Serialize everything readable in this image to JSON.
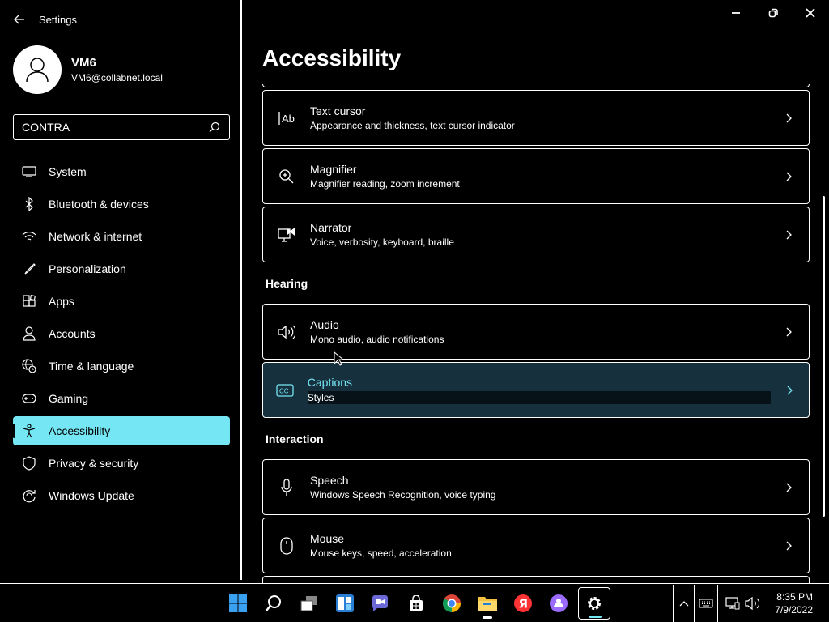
{
  "app": {
    "title": "Settings"
  },
  "user": {
    "name": "VM6",
    "email": "VM6@collabnet.local"
  },
  "search": {
    "value": "CONTRA",
    "icon": "search-icon"
  },
  "nav": {
    "items": [
      {
        "label": "System",
        "icon": "monitor-icon"
      },
      {
        "label": "Bluetooth & devices",
        "icon": "bluetooth-icon"
      },
      {
        "label": "Network & internet",
        "icon": "wifi-icon"
      },
      {
        "label": "Personalization",
        "icon": "brush-icon"
      },
      {
        "label": "Apps",
        "icon": "apps-icon"
      },
      {
        "label": "Accounts",
        "icon": "person-icon"
      },
      {
        "label": "Time & language",
        "icon": "globe-clock-icon"
      },
      {
        "label": "Gaming",
        "icon": "gamepad-icon"
      },
      {
        "label": "Accessibility",
        "icon": "accessibility-icon"
      },
      {
        "label": "Privacy & security",
        "icon": "shield-icon"
      },
      {
        "label": "Windows Update",
        "icon": "update-icon"
      }
    ],
    "selected": "Accessibility"
  },
  "main": {
    "title": "Accessibility",
    "cards": [
      {
        "title": "Text cursor",
        "desc": "Appearance and thickness, text cursor indicator",
        "icon": "text-cursor-icon"
      },
      {
        "title": "Magnifier",
        "desc": "Magnifier reading, zoom increment",
        "icon": "magnifier-icon"
      },
      {
        "title": "Narrator",
        "desc": "Voice, verbosity, keyboard, braille",
        "icon": "narrator-icon"
      },
      {
        "title": "Audio",
        "desc": "Mono audio, audio notifications",
        "icon": "speaker-icon"
      },
      {
        "title": "Captions",
        "desc": "Styles",
        "icon": "captions-icon"
      },
      {
        "title": "Speech",
        "desc": "Windows Speech Recognition, voice typing",
        "icon": "microphone-icon"
      },
      {
        "title": "Mouse",
        "desc": "Mouse keys, speed, acceleration",
        "icon": "mouse-icon"
      }
    ],
    "sections": {
      "hearing": "Hearing",
      "interaction": "Interaction"
    }
  },
  "window": {
    "minimize": "minimize-icon",
    "restore": "restore-icon",
    "close": "close-icon"
  },
  "taskbar": {
    "apps": [
      "start-icon",
      "search-icon",
      "task-view-icon",
      "widgets-icon",
      "chat-icon",
      "store-icon",
      "chrome-icon",
      "file-explorer-icon",
      "yandex-icon",
      "alice-icon",
      "settings-icon"
    ],
    "time": "8:35 PM",
    "date": "7/9/2022"
  },
  "colors": {
    "accent": "#75e6f4",
    "hover_card": "#17303d",
    "background": "#000000"
  }
}
